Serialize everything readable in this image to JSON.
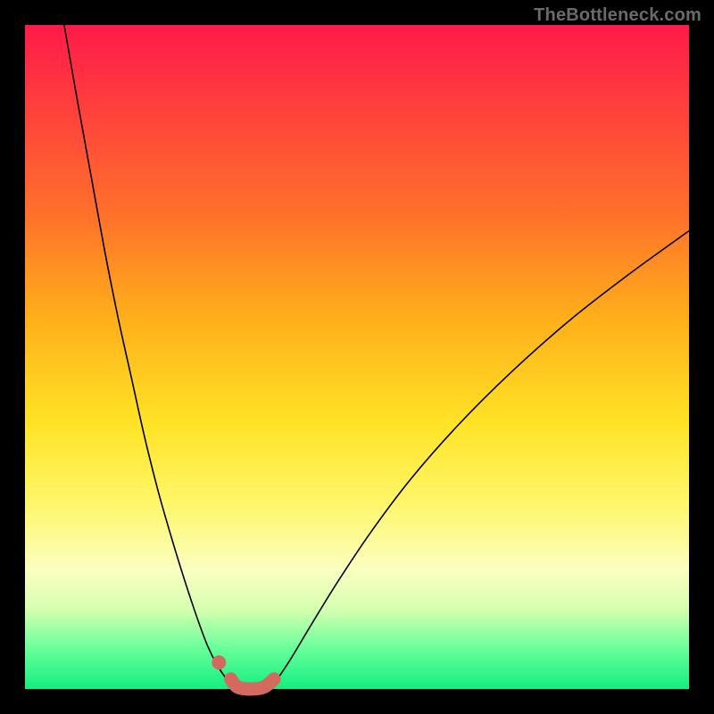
{
  "watermark": "TheBottleneck.com",
  "chart_data": {
    "type": "line",
    "title": "",
    "xlabel": "",
    "ylabel": "",
    "xlim": [
      0,
      100
    ],
    "ylim": [
      0,
      100
    ],
    "series": [
      {
        "name": "left-branch",
        "x": [
          5.9,
          8,
          10,
          12,
          14,
          16,
          18,
          20,
          22,
          24,
          26,
          27.5,
          29,
          30.5,
          31.5
        ],
        "y": [
          100,
          88,
          77,
          66,
          56,
          47,
          38,
          30,
          23,
          16.5,
          10.5,
          6.5,
          3.5,
          1.3,
          0.2
        ]
      },
      {
        "name": "right-branch",
        "x": [
          37,
          38,
          40,
          43,
          47,
          52,
          58,
          65,
          73,
          82,
          91,
          100
        ],
        "y": [
          0.2,
          1.5,
          4.5,
          9.5,
          16,
          23.5,
          31.5,
          39.5,
          47.5,
          55.5,
          62.5,
          69
        ]
      },
      {
        "name": "highlight-zone",
        "x": [
          31,
          32,
          34,
          36,
          37.5
        ],
        "y": [
          1.5,
          0.3,
          0,
          0.3,
          1.5
        ]
      }
    ],
    "annotations": [
      {
        "name": "highlight-dot",
        "x": 29.2,
        "y": 4
      }
    ],
    "background_gradient": {
      "top": "#ff1a49",
      "mid1": "#ffb21a",
      "mid2": "#fff66a",
      "bottom": "#12ef80"
    }
  }
}
